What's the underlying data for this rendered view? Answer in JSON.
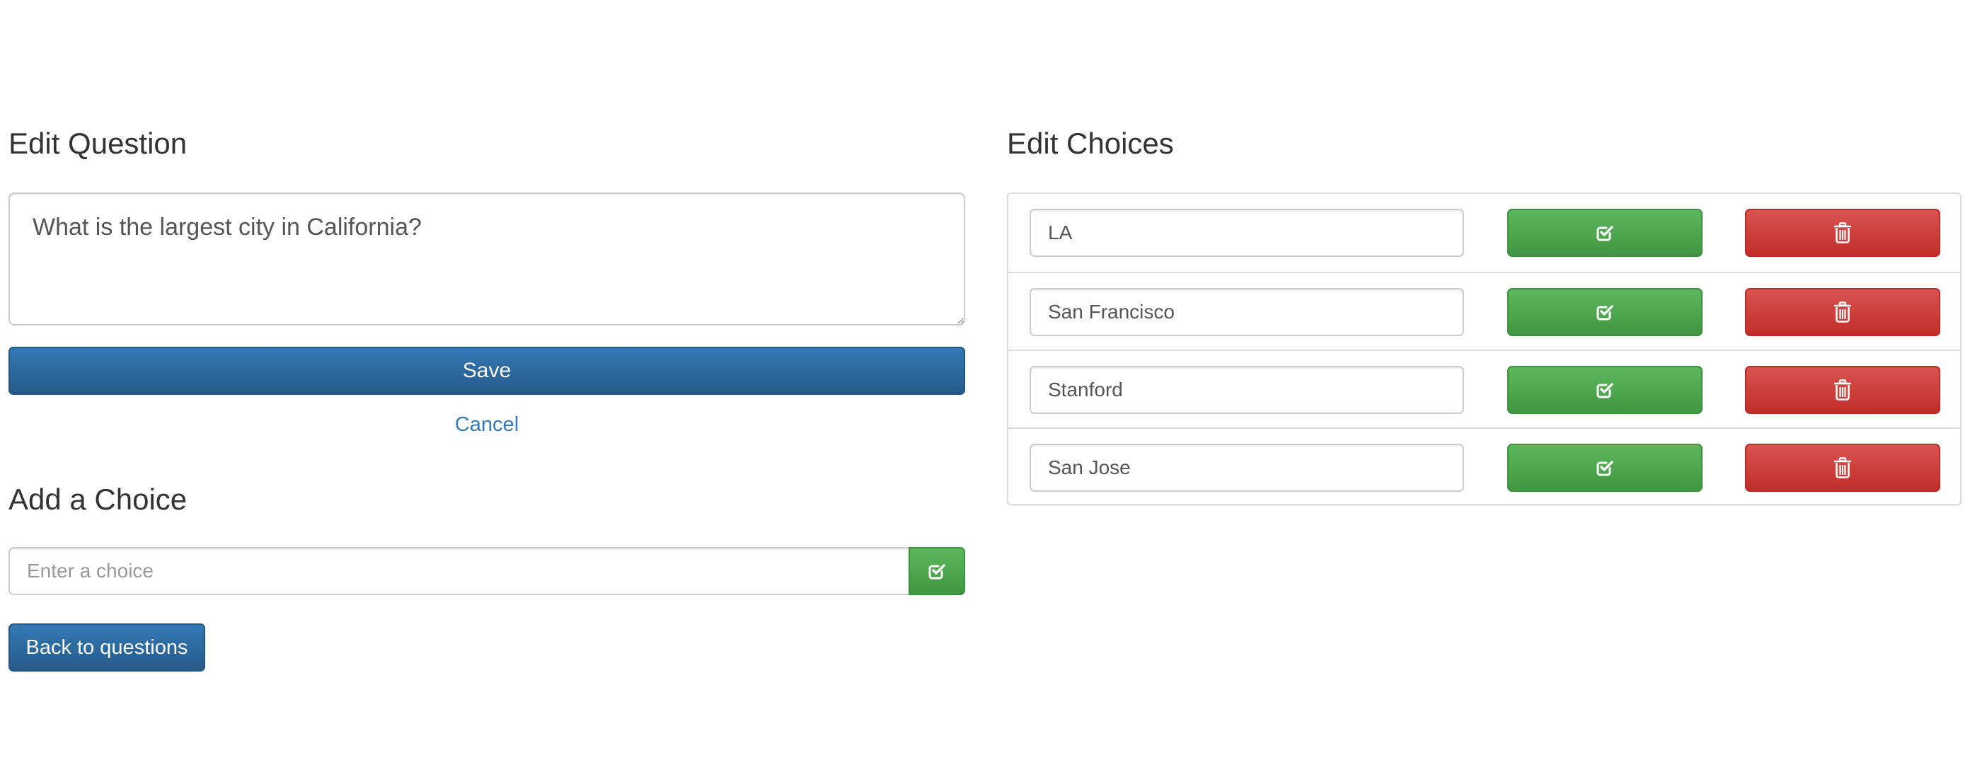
{
  "edit_question": {
    "heading": "Edit Question",
    "question_text": "What is the largest city in California?",
    "save_label": "Save",
    "cancel_label": "Cancel"
  },
  "add_choice": {
    "heading": "Add a Choice",
    "placeholder": "Enter a choice",
    "add_icon": "check-square-icon"
  },
  "back_label": "Back to questions",
  "edit_choices": {
    "heading": "Edit Choices",
    "choices": [
      {
        "value": "LA",
        "save_icon": "check-square-icon",
        "delete_icon": "trash-icon"
      },
      {
        "value": "San Francisco",
        "save_icon": "check-square-icon",
        "delete_icon": "trash-icon"
      },
      {
        "value": "Stanford",
        "save_icon": "check-square-icon",
        "delete_icon": "trash-icon"
      },
      {
        "value": "San Jose",
        "save_icon": "check-square-icon",
        "delete_icon": "trash-icon"
      }
    ]
  },
  "colors": {
    "primary": "#337ab7",
    "success": "#5cb85c",
    "danger": "#d9534f"
  }
}
